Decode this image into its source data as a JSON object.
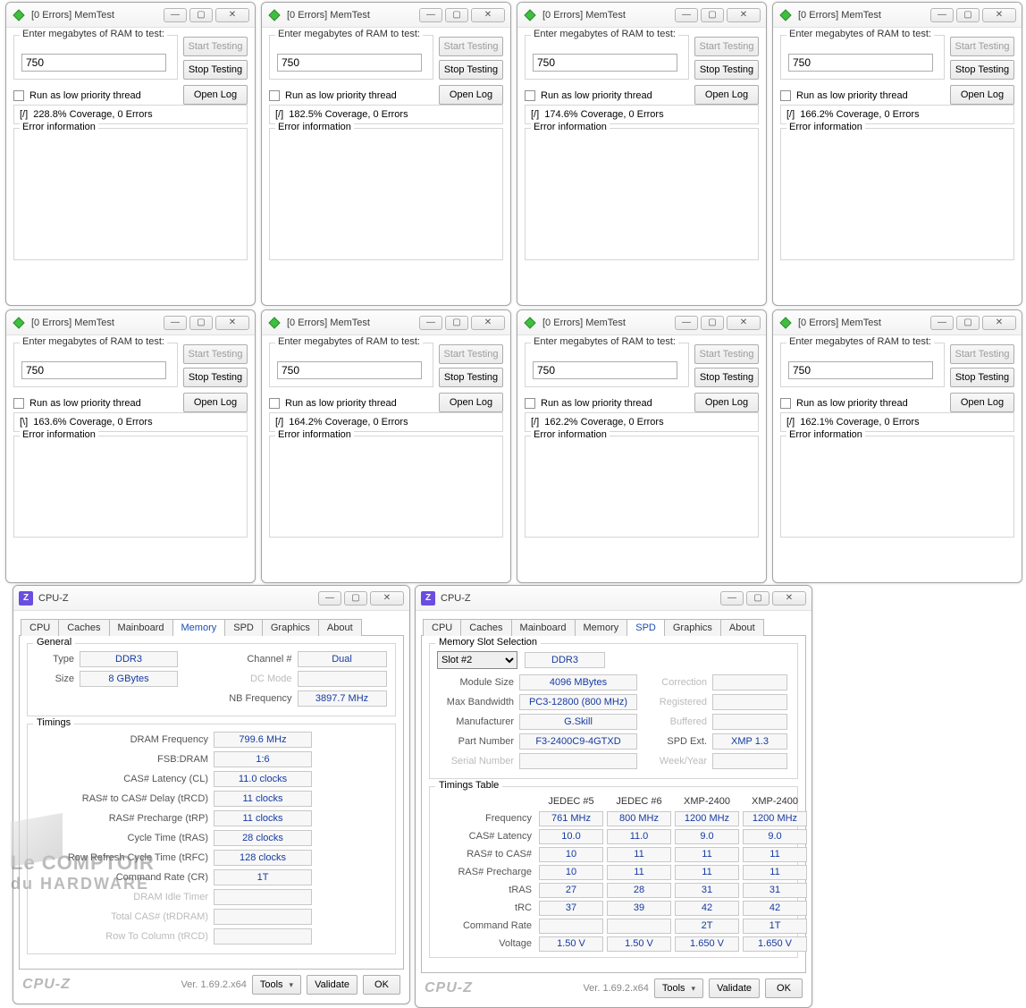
{
  "memtest": {
    "title_prefix": "[0 Errors] MemTest",
    "ram_label": "Enter megabytes of RAM to test:",
    "ram_value": "750",
    "start_btn": "Start Testing",
    "stop_btn": "Stop Testing",
    "openlog_btn": "Open Log",
    "lowprio_label": "Run as low priority thread",
    "errinfo_label": "Error information",
    "instances": [
      {
        "spinner": "[/]",
        "coverage": "228.8% Coverage, 0 Errors"
      },
      {
        "spinner": "[/]",
        "coverage": "182.5% Coverage, 0 Errors"
      },
      {
        "spinner": "[/]",
        "coverage": "174.6% Coverage, 0 Errors"
      },
      {
        "spinner": "[/]",
        "coverage": "166.2% Coverage, 0 Errors"
      },
      {
        "spinner": "[\\]",
        "coverage": "163.6% Coverage, 0 Errors"
      },
      {
        "spinner": "[/]",
        "coverage": "164.2% Coverage, 0 Errors"
      },
      {
        "spinner": "[/]",
        "coverage": "162.2% Coverage, 0 Errors"
      },
      {
        "spinner": "[/]",
        "coverage": "162.1% Coverage, 0 Errors"
      }
    ]
  },
  "cpuz": {
    "title": "CPU-Z",
    "tabs": [
      "CPU",
      "Caches",
      "Mainboard",
      "Memory",
      "SPD",
      "Graphics",
      "About"
    ],
    "brand": "CPU-Z",
    "version": "Ver. 1.69.2.x64",
    "tools_btn": "Tools",
    "validate_btn": "Validate",
    "ok_btn": "OK",
    "memory": {
      "general_legend": "General",
      "timings_legend": "Timings",
      "type_k": "Type",
      "type_v": "DDR3",
      "size_k": "Size",
      "size_v": "8 GBytes",
      "channel_k": "Channel #",
      "channel_v": "Dual",
      "dcmode_k": "DC Mode",
      "dcmode_v": "",
      "nbfreq_k": "NB Frequency",
      "nbfreq_v": "3897.7 MHz",
      "rows": [
        {
          "k": "DRAM Frequency",
          "v": "799.6 MHz"
        },
        {
          "k": "FSB:DRAM",
          "v": "1:6"
        },
        {
          "k": "CAS# Latency (CL)",
          "v": "11.0 clocks"
        },
        {
          "k": "RAS# to CAS# Delay (tRCD)",
          "v": "11 clocks"
        },
        {
          "k": "RAS# Precharge (tRP)",
          "v": "11 clocks"
        },
        {
          "k": "Cycle Time (tRAS)",
          "v": "28 clocks"
        },
        {
          "k": "Row Refresh Cycle Time (tRFC)",
          "v": "128 clocks"
        },
        {
          "k": "Command Rate (CR)",
          "v": "1T"
        },
        {
          "k": "DRAM Idle Timer",
          "v": ""
        },
        {
          "k": "Total CAS# (tRDRAM)",
          "v": ""
        },
        {
          "k": "Row To Column (tRCD)",
          "v": ""
        }
      ]
    },
    "spd": {
      "slot_legend": "Memory Slot Selection",
      "timings_legend": "Timings Table",
      "slot_value": "Slot #2",
      "slot_type": "DDR3",
      "module_size_k": "Module Size",
      "module_size_v": "4096 MBytes",
      "max_bw_k": "Max Bandwidth",
      "max_bw_v": "PC3-12800 (800 MHz)",
      "manufacturer_k": "Manufacturer",
      "manufacturer_v": "G.Skill",
      "partnum_k": "Part Number",
      "partnum_v": "F3-2400C9-4GTXD",
      "serial_k": "Serial Number",
      "serial_v": "",
      "correction_k": "Correction",
      "correction_v": "",
      "registered_k": "Registered",
      "registered_v": "",
      "buffered_k": "Buffered",
      "buffered_v": "",
      "spdext_k": "SPD Ext.",
      "spdext_v": "XMP 1.3",
      "weekyear_k": "Week/Year",
      "weekyear_v": "",
      "cols": [
        "JEDEC #5",
        "JEDEC #6",
        "XMP-2400",
        "XMP-2400"
      ],
      "rows": [
        {
          "k": "Frequency",
          "c": [
            "761 MHz",
            "800 MHz",
            "1200 MHz",
            "1200 MHz"
          ]
        },
        {
          "k": "CAS# Latency",
          "c": [
            "10.0",
            "11.0",
            "9.0",
            "9.0"
          ]
        },
        {
          "k": "RAS# to CAS#",
          "c": [
            "10",
            "11",
            "11",
            "11"
          ]
        },
        {
          "k": "RAS# Precharge",
          "c": [
            "10",
            "11",
            "11",
            "11"
          ]
        },
        {
          "k": "tRAS",
          "c": [
            "27",
            "28",
            "31",
            "31"
          ]
        },
        {
          "k": "tRC",
          "c": [
            "37",
            "39",
            "42",
            "42"
          ]
        },
        {
          "k": "Command Rate",
          "c": [
            "",
            "",
            "2T",
            "1T"
          ]
        },
        {
          "k": "Voltage",
          "c": [
            "1.50 V",
            "1.50 V",
            "1.650 V",
            "1.650 V"
          ]
        }
      ]
    }
  },
  "watermark": {
    "line1": "Le COMPTOIR",
    "line2": "du HARDWARE"
  }
}
